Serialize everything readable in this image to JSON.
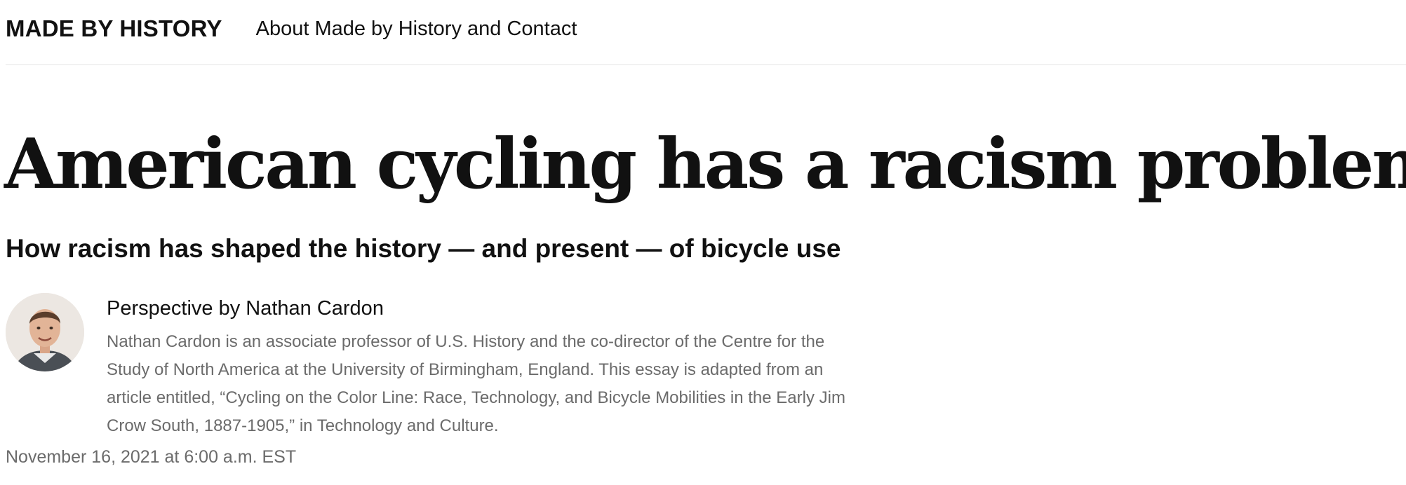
{
  "nav": {
    "brand": "MADE BY HISTORY",
    "about_link": "About Made by History and Contact"
  },
  "article": {
    "headline": "American cycling has a racism problem",
    "subheadline": "How racism has shaped the history — and present — of bicycle use",
    "byline": "Perspective by Nathan Cardon",
    "author_bio": "Nathan Cardon is an associate professor of U.S. History and the co-director of the Centre for the Study of North America at the University of Birmingham, England. This essay is adapted from an article entitled, “Cycling on the Color Line: Race, Technology, and Bicycle Mobilities in the Early Jim Crow South, 1887-1905,” in Technology and Culture.",
    "timestamp": "November 16, 2021 at 6:00 a.m. EST"
  }
}
